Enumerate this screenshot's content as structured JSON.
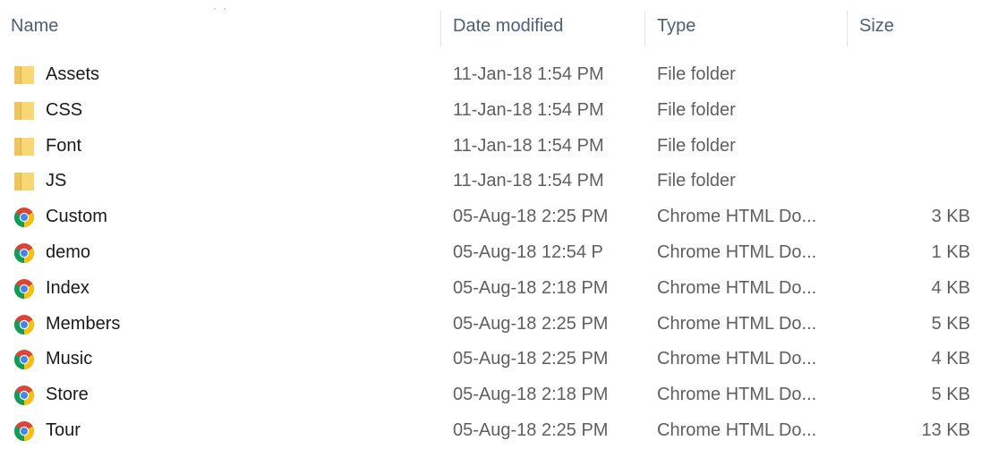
{
  "columns": {
    "name": "Name",
    "date": "Date modified",
    "type": "Type",
    "size": "Size"
  },
  "files": [
    {
      "name": "Assets",
      "date": "11-Jan-18 1:54 PM",
      "type": "File folder",
      "size": "",
      "icon": "folder-icon"
    },
    {
      "name": "CSS",
      "date": "11-Jan-18 1:54 PM",
      "type": "File folder",
      "size": "",
      "icon": "folder-icon"
    },
    {
      "name": "Font",
      "date": "11-Jan-18 1:54 PM",
      "type": "File folder",
      "size": "",
      "icon": "folder-icon"
    },
    {
      "name": "JS",
      "date": "11-Jan-18 1:54 PM",
      "type": "File folder",
      "size": "",
      "icon": "folder-icon"
    },
    {
      "name": "Custom",
      "date": "05-Aug-18 2:25 PM",
      "type": "Chrome HTML Do...",
      "size": "3 KB",
      "icon": "chrome-icon"
    },
    {
      "name": "demo",
      "date": "05-Aug-18 12:54 P",
      "type": "Chrome HTML Do...",
      "size": "1 KB",
      "icon": "chrome-icon"
    },
    {
      "name": "Index",
      "date": "05-Aug-18 2:18 PM",
      "type": "Chrome HTML Do...",
      "size": "4 KB",
      "icon": "chrome-icon"
    },
    {
      "name": "Members",
      "date": "05-Aug-18 2:25 PM",
      "type": "Chrome HTML Do...",
      "size": "5 KB",
      "icon": "chrome-icon"
    },
    {
      "name": "Music",
      "date": "05-Aug-18 2:25 PM",
      "type": "Chrome HTML Do...",
      "size": "4 KB",
      "icon": "chrome-icon"
    },
    {
      "name": "Store",
      "date": "05-Aug-18 2:18 PM",
      "type": "Chrome HTML Do...",
      "size": "5 KB",
      "icon": "chrome-icon"
    },
    {
      "name": "Tour",
      "date": "05-Aug-18 2:25 PM",
      "type": "Chrome HTML Do...",
      "size": "13 KB",
      "icon": "chrome-icon"
    }
  ],
  "colors": {
    "header_text": "#4c607a",
    "name_text": "#1a1a1a",
    "detail_text": "#5f5f5f",
    "folder": "#f8d775",
    "chrome_red": "#db4437",
    "chrome_yellow": "#f4c20d",
    "chrome_green": "#0f9d58",
    "chrome_blue": "#4285f4"
  }
}
